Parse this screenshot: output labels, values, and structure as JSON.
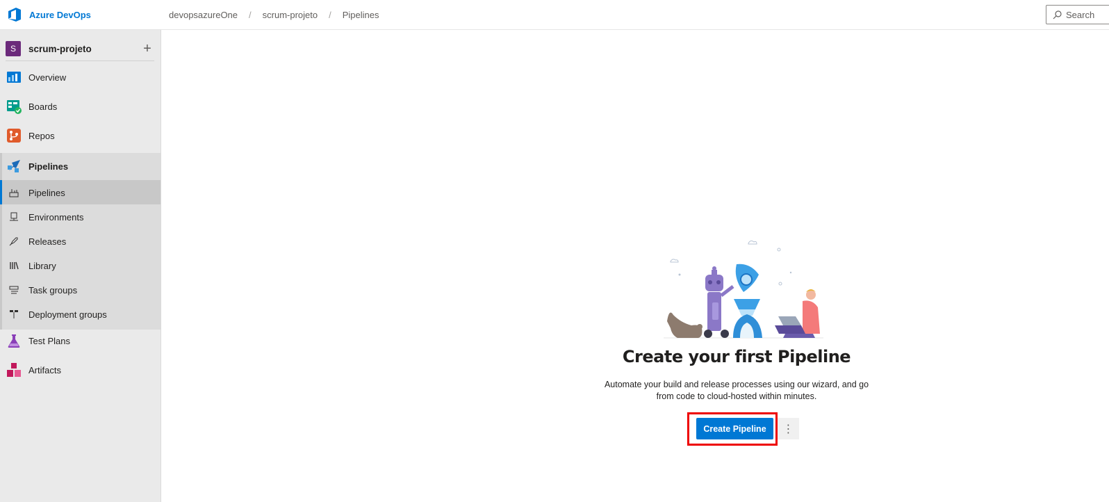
{
  "topbar": {
    "brand": "Azure DevOps",
    "breadcrumb": [
      "devopsazureOne",
      "scrum-projeto",
      "Pipelines"
    ],
    "breadcrumb_separator": "/",
    "search_placeholder": "Search"
  },
  "sidebar": {
    "project_initial": "S",
    "project_name": "scrum-projeto",
    "project_add": "+",
    "items": [
      {
        "label": "Overview",
        "icon": "overview-icon"
      },
      {
        "label": "Boards",
        "icon": "boards-icon"
      },
      {
        "label": "Repos",
        "icon": "repos-icon"
      },
      {
        "label": "Pipelines",
        "icon": "pipelines-icon"
      },
      {
        "label": "Test Plans",
        "icon": "test-plans-icon"
      },
      {
        "label": "Artifacts",
        "icon": "artifacts-icon"
      }
    ],
    "pipelines_sub": [
      {
        "label": "Pipelines",
        "icon": "pipelines-sub-icon",
        "selected": true
      },
      {
        "label": "Environments",
        "icon": "environments-icon"
      },
      {
        "label": "Releases",
        "icon": "releases-icon"
      },
      {
        "label": "Library",
        "icon": "library-icon"
      },
      {
        "label": "Task groups",
        "icon": "task-groups-icon"
      },
      {
        "label": "Deployment groups",
        "icon": "deployment-groups-icon"
      }
    ]
  },
  "main": {
    "title": "Create your first Pipeline",
    "description": "Automate your build and release processes using our wizard, and go from code to cloud-hosted within minutes.",
    "cta_label": "Create Pipeline",
    "more_label": "⋮"
  },
  "colors": {
    "accent": "#0078d4",
    "highlight": "#e00000",
    "project_badge": "#6b2a7b"
  }
}
